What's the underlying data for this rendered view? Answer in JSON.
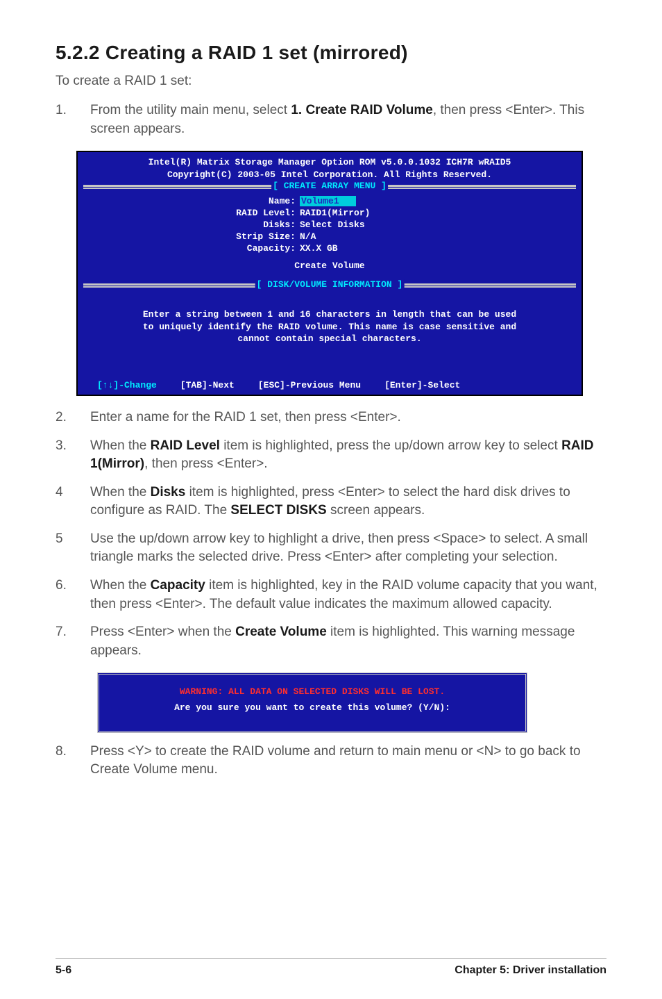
{
  "heading": "5.2.2   Creating a RAID 1 set (mirrored)",
  "intro": "To create a RAID 1 set:",
  "step1": {
    "num": "1.",
    "pre": "From the utility main menu, select ",
    "bold": "1. Create RAID Volume",
    "post": ", then press <Enter>. This screen appears."
  },
  "terminal": {
    "header1": "Intel(R) Matrix Storage Manager Option ROM v5.0.0.1032 ICH7R wRAID5",
    "header2": "Copyright(C) 2003-05 Intel Corporation. All Rights Reserved.",
    "sep1": "[ CREATE ARRAY MENU ]",
    "fields": {
      "name_label": "Name:",
      "name_value": "Volume1",
      "raid_label": "RAID Level:",
      "raid_value": "RAID1(Mirror)",
      "disks_label": "Disks:",
      "disks_value": "Select Disks",
      "strip_label": "Strip Size:",
      "strip_value": "N/A",
      "cap_label": "Capacity:",
      "cap_value": "XX.X  GB"
    },
    "create": "Create Volume",
    "sep2": "[ DISK/VOLUME INFORMATION ]",
    "info1": "Enter a string between 1 and 16 characters in length that can be used",
    "info2": "to uniquely identify the RAID volume. This name is case sensitive and",
    "info3": "cannot contain special characters.",
    "foot1": "[↑↓]-Change",
    "foot2": "[TAB]-Next",
    "foot3": "[ESC]-Previous Menu",
    "foot4": "[Enter]-Select"
  },
  "step2": {
    "num": "2.",
    "text": "Enter a name for the RAID 1 set, then press <Enter>."
  },
  "step3": {
    "num": "3.",
    "a": "When the ",
    "b": "RAID Level",
    "c": " item is highlighted, press the up/down arrow key to select ",
    "d": "RAID 1(Mirror)",
    "e": ", then press <Enter>."
  },
  "step4": {
    "num": "4",
    "a": "When the ",
    "b": "Disks",
    "c": " item is highlighted, press <Enter> to select the hard disk drives to configure as RAID. The ",
    "d": "SELECT DISKS",
    "e": " screen appears."
  },
  "step5": {
    "num": "5",
    "text": "Use the up/down arrow key to highlight a drive, then press <Space> to select. A small triangle marks the selected drive. Press <Enter> after completing your selection."
  },
  "step6": {
    "num": "6.",
    "a": "When the ",
    "b": "Capacity",
    "c": " item is highlighted, key in the RAID volume capacity that you want, then press <Enter>. The default value indicates the maximum allowed capacity."
  },
  "step7": {
    "num": "7.",
    "a": "Press <Enter> when the ",
    "b": "Create Volume",
    "c": " item is highlighted. This warning message appears."
  },
  "warning": {
    "line1": "WARNING: ALL DATA ON SELECTED DISKS WILL BE LOST.",
    "line2": "Are you sure you want to create this volume? (Y/N):"
  },
  "step8": {
    "num": "8.",
    "text": "Press <Y> to create the RAID volume and return to main menu or <N> to go back to Create Volume menu."
  },
  "footer": {
    "page": "5-6",
    "chapter": "Chapter 5: Driver installation"
  }
}
